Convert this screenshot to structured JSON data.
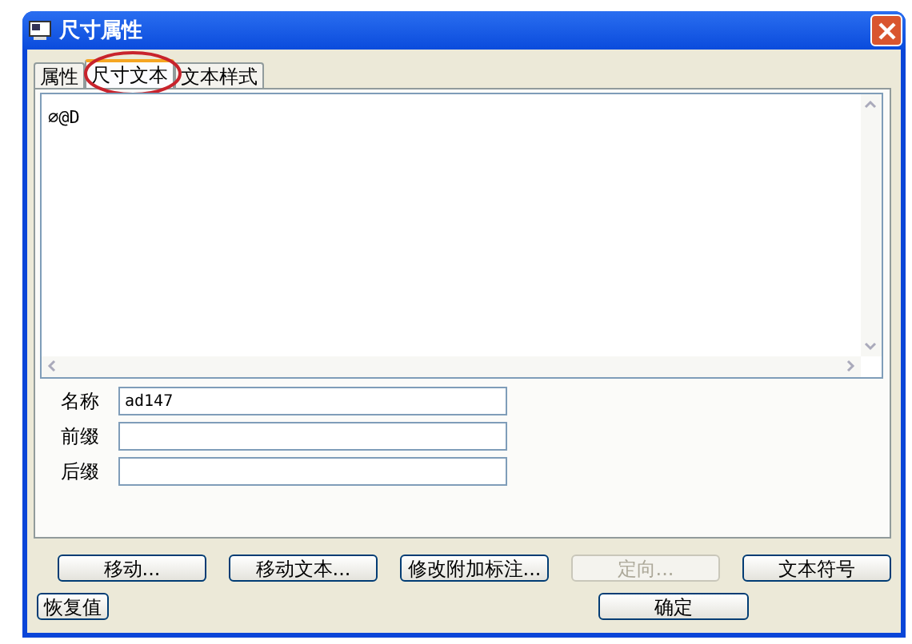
{
  "window": {
    "title": "尺寸属性"
  },
  "tabs": [
    {
      "label": "属性",
      "selected": false
    },
    {
      "label": "尺寸文本",
      "selected": true
    },
    {
      "label": "文本样式",
      "selected": false
    }
  ],
  "text_area": {
    "value": "∅@D"
  },
  "fields": [
    {
      "label": "名称",
      "value": "ad147"
    },
    {
      "label": "前缀"
    },
    {
      "label": "后缀"
    }
  ],
  "buttons": [
    {
      "label": "移动...",
      "disabled": false
    },
    {
      "label": "移动文本...",
      "disabled": false
    },
    {
      "label": "修改附加标注...",
      "disabled": false
    },
    {
      "label": "定向...",
      "disabled": true
    },
    {
      "label": "文本符号",
      "disabled": false
    }
  ],
  "footer_buttons": [
    {
      "label": "恢复值"
    },
    {
      "label": "确定"
    }
  ]
}
